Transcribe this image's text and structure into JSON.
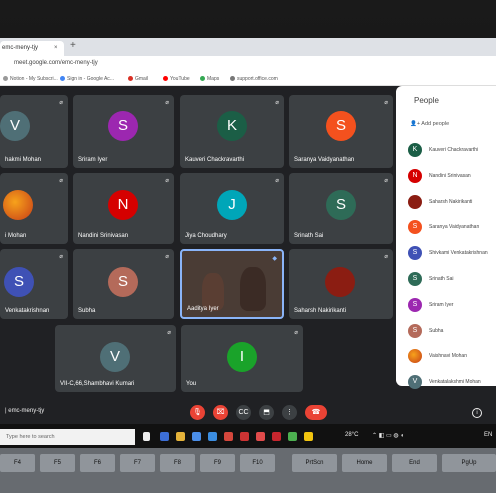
{
  "browser": {
    "tab_title": "emc-meny-tjy",
    "url": "meet.google.com/emc-meny-tjy",
    "bookmarks": [
      {
        "label": "Notion - My Subscri...",
        "color": "#999999"
      },
      {
        "label": "Sign in - Google Ac...",
        "color": "#4285f4"
      },
      {
        "label": "Gmail",
        "color": "#d93025"
      },
      {
        "label": "YouTube",
        "color": "#ff0000"
      },
      {
        "label": "Maps",
        "color": "#34a853"
      },
      {
        "label": "support.office.com",
        "color": "#777777"
      }
    ]
  },
  "meeting": {
    "participants": [
      {
        "name": "hakmi Mohan",
        "initial": "V",
        "color": "#4f6f76"
      },
      {
        "name": "Sriram Iyer",
        "initial": "S",
        "color": "#9c27b0"
      },
      {
        "name": "Kauveri Chackravarthi",
        "initial": "K",
        "color": "#1b5e46"
      },
      {
        "name": "Saranya Vaidyanathan",
        "initial": "S",
        "color": "#f4511e"
      },
      {
        "name": "i Mohan",
        "initial": "",
        "color": "#e46b1f"
      },
      {
        "name": "Nandini Srinivasan",
        "initial": "N",
        "color": "#d50000"
      },
      {
        "name": "Jiya Choudhary",
        "initial": "J",
        "color": "#00a6b8"
      },
      {
        "name": "Srinath Sai",
        "initial": "S",
        "color": "#2e6b57"
      },
      {
        "name": "Venkatakrishnan",
        "initial": "S",
        "color": "#3f51b5"
      },
      {
        "name": "Subha",
        "initial": "S",
        "color": "#b46a5a"
      },
      {
        "name": "Aaditya Iyer",
        "initial": "",
        "color": "#4a3c35"
      },
      {
        "name": "Saharsh Nakirikanti",
        "initial": "",
        "color": "#8b1d12"
      },
      {
        "name": "VII-C,66,Shambhavi Kumari",
        "initial": "V",
        "color": "#4f6f76"
      },
      {
        "name": "You",
        "initial": "I",
        "color": "#1aa32a"
      }
    ],
    "meeting_code": "| emc-meny-tjy"
  },
  "people_panel": {
    "title": "People",
    "add_label": "Add people",
    "people": [
      {
        "name": "Kauveri Chackravarthi",
        "initial": "K",
        "color": "#1b5e46"
      },
      {
        "name": "Nandini Srinivasan",
        "initial": "N",
        "color": "#d50000"
      },
      {
        "name": "Saharsh Nakirikanti",
        "initial": "",
        "color": "#8b1d12"
      },
      {
        "name": "Saranya Vaidyanathan",
        "initial": "S",
        "color": "#f4511e"
      },
      {
        "name": "Shivkami Venkatakrishnan",
        "initial": "S",
        "color": "#3f51b5"
      },
      {
        "name": "Srinath Sai",
        "initial": "S",
        "color": "#2e6b57"
      },
      {
        "name": "Sriram Iyer",
        "initial": "S",
        "color": "#9c27b0"
      },
      {
        "name": "Subha",
        "initial": "S",
        "color": "#b46a5a"
      },
      {
        "name": "Vaishnavi Mohan",
        "initial": "",
        "color": "#e46b1f"
      },
      {
        "name": "Venkatalakshmi Mohan",
        "initial": "V",
        "color": "#4f6f76"
      }
    ]
  },
  "taskbar": {
    "search_placeholder": "Type here to search",
    "weather": "28°C",
    "language": "EN"
  },
  "keyboard": {
    "keys": [
      "F4",
      "F5",
      "F6",
      "F7",
      "F8",
      "F9",
      "F10",
      "PrtScn",
      "Home",
      "End",
      "PgUp"
    ]
  }
}
